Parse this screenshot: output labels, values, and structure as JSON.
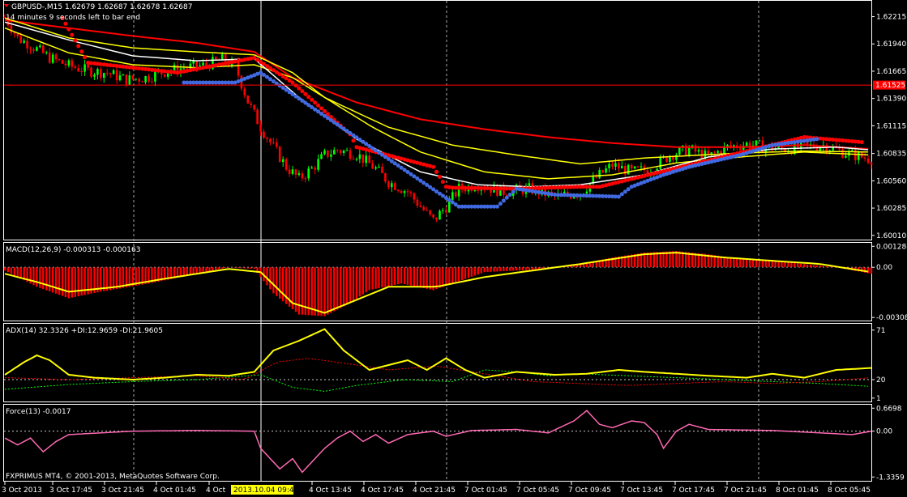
{
  "header": {
    "symbol_line": "GBPUSD-,M15  1.62679 1.62687 1.62678 1.62687",
    "timer_line": "14 minutes 9 seconds left to bar end"
  },
  "colors": {
    "background": "#000000",
    "frame": "#ffffff",
    "bull_candle": "#00ff00",
    "bear_candle": "#ff0000",
    "ma_red": "#ff0000",
    "ma_yellow": "#ffff00",
    "ma_white": "#ffffff",
    "stop_red": "#ff0000",
    "stop_blue": "#4169e1",
    "macd_hist": "#ff0000",
    "macd_signal": "#ffff00",
    "adx_line": "#ffff00",
    "plus_di": "#00ff00",
    "minus_di": "#ff0000",
    "force_line": "#ff69b4",
    "price_tag": "#ff0000"
  },
  "copyright": "FXPRIMUS MT4, © 2001-2013, MetaQuotes Software Corp.",
  "chart_data": [
    {
      "type": "candlestick",
      "title": "GBPUSD-,M15",
      "yticks": [
        "1.62215",
        "1.61940",
        "1.61665",
        "1.61390",
        "1.61115",
        "1.60835",
        "1.60560",
        "1.60285",
        "1.60010"
      ],
      "ylim": [
        1.6,
        1.6235
      ],
      "price_line": 1.61525,
      "price_line_label": "1.61525",
      "x_labels": [
        "3 Oct 2013",
        "3 Oct 17:45",
        "3 Oct 21:45",
        "4 Oct 01:45",
        "4 Oct",
        "4 Oct 13:45",
        "4 Oct 17:45",
        "4 Oct 21:45",
        "7 Oct 01:45",
        "7 Oct 05:45",
        "7 Oct 09:45",
        "7 Oct 13:45",
        "7 Oct 17:45",
        "7 Oct 21:45",
        "8 Oct 01:45",
        "8 Oct 05:45"
      ],
      "highlight_label": "2013.10.04 09:45",
      "close_path": [
        [
          0,
          1.6221
        ],
        [
          4,
          1.62
        ],
        [
          8,
          1.6193
        ],
        [
          14,
          1.618
        ],
        [
          20,
          1.6172
        ],
        [
          26,
          1.6167
        ],
        [
          32,
          1.6165
        ],
        [
          38,
          1.6158
        ],
        [
          44,
          1.616
        ],
        [
          50,
          1.6166
        ],
        [
          56,
          1.617
        ],
        [
          62,
          1.6172
        ],
        [
          68,
          1.6178
        ],
        [
          72,
          1.6172
        ],
        [
          76,
          1.6136
        ],
        [
          80,
          1.611
        ],
        [
          84,
          1.609
        ],
        [
          88,
          1.607
        ],
        [
          92,
          1.6058
        ],
        [
          96,
          1.6068
        ],
        [
          100,
          1.6082
        ],
        [
          104,
          1.6087
        ],
        [
          110,
          1.6083
        ],
        [
          116,
          1.6068
        ],
        [
          120,
          1.6055
        ],
        [
          126,
          1.6045
        ],
        [
          130,
          1.603
        ],
        [
          134,
          1.6016
        ],
        [
          138,
          1.603
        ],
        [
          142,
          1.6048
        ],
        [
          148,
          1.6052
        ],
        [
          156,
          1.6045
        ],
        [
          164,
          1.6048
        ],
        [
          172,
          1.604
        ],
        [
          180,
          1.6044
        ],
        [
          186,
          1.6062
        ],
        [
          190,
          1.6072
        ],
        [
          196,
          1.6065
        ],
        [
          202,
          1.6068
        ],
        [
          208,
          1.6082
        ],
        [
          214,
          1.6088
        ],
        [
          220,
          1.608
        ],
        [
          226,
          1.609
        ],
        [
          232,
          1.6093
        ],
        [
          238,
          1.609
        ],
        [
          244,
          1.6088
        ],
        [
          250,
          1.609
        ],
        [
          256,
          1.6092
        ],
        [
          262,
          1.6085
        ],
        [
          268,
          1.608
        ],
        [
          271,
          1.6078
        ]
      ],
      "ma_red": [
        [
          0,
          1.6218
        ],
        [
          20,
          1.621
        ],
        [
          40,
          1.6202
        ],
        [
          60,
          1.6195
        ],
        [
          78,
          1.6186
        ],
        [
          90,
          1.616
        ],
        [
          110,
          1.6135
        ],
        [
          130,
          1.6118
        ],
        [
          150,
          1.6108
        ],
        [
          170,
          1.61
        ],
        [
          190,
          1.6094
        ],
        [
          210,
          1.609
        ],
        [
          230,
          1.609
        ],
        [
          250,
          1.6092
        ],
        [
          271,
          1.6088
        ]
      ],
      "ma_yellow_upper": [
        [
          0,
          1.622
        ],
        [
          20,
          1.62
        ],
        [
          40,
          1.619
        ],
        [
          60,
          1.6186
        ],
        [
          78,
          1.6183
        ],
        [
          90,
          1.6165
        ],
        [
          100,
          1.614
        ],
        [
          120,
          1.611
        ],
        [
          140,
          1.6092
        ],
        [
          160,
          1.6082
        ],
        [
          180,
          1.6073
        ],
        [
          200,
          1.6079
        ],
        [
          230,
          1.6084
        ],
        [
          250,
          1.6086
        ],
        [
          271,
          1.6085
        ]
      ],
      "ma_yellow_lower": [
        [
          0,
          1.621
        ],
        [
          20,
          1.6185
        ],
        [
          40,
          1.6173
        ],
        [
          60,
          1.617
        ],
        [
          78,
          1.6173
        ],
        [
          90,
          1.616
        ],
        [
          100,
          1.614
        ],
        [
          115,
          1.611
        ],
        [
          130,
          1.6085
        ],
        [
          150,
          1.6065
        ],
        [
          170,
          1.6058
        ],
        [
          190,
          1.6062
        ],
        [
          210,
          1.6074
        ],
        [
          230,
          1.608
        ],
        [
          250,
          1.6085
        ],
        [
          271,
          1.6082
        ]
      ],
      "ma_white": [
        [
          0,
          1.6216
        ],
        [
          20,
          1.6198
        ],
        [
          40,
          1.6182
        ],
        [
          60,
          1.6177
        ],
        [
          78,
          1.6179
        ],
        [
          92,
          1.614
        ],
        [
          110,
          1.6098
        ],
        [
          130,
          1.6065
        ],
        [
          148,
          1.6052
        ],
        [
          164,
          1.605
        ],
        [
          180,
          1.6052
        ],
        [
          200,
          1.6062
        ],
        [
          220,
          1.608
        ],
        [
          240,
          1.6088
        ],
        [
          260,
          1.609
        ],
        [
          271,
          1.6087
        ]
      ],
      "stop_red": [
        [
          18,
          1.622
        ],
        [
          26,
          1.6175
        ],
        [
          40,
          1.617
        ],
        [
          54,
          1.6165
        ],
        [
          78,
          1.618
        ],
        [
          90,
          1.6155
        ],
        [
          108,
          1.6103
        ],
        [
          110,
          1.609
        ],
        [
          134,
          1.607
        ],
        [
          138,
          1.605
        ],
        [
          140,
          1.6049
        ],
        [
          160,
          1.6048
        ],
        [
          180,
          1.605
        ],
        [
          186,
          1.605
        ],
        [
          250,
          1.61
        ],
        [
          268,
          1.6095
        ]
      ],
      "stop_blue": [
        [
          56,
          1.6155
        ],
        [
          72,
          1.6155
        ],
        [
          80,
          1.6165
        ],
        [
          142,
          1.603
        ],
        [
          154,
          1.603
        ],
        [
          160,
          1.6048
        ],
        [
          172,
          1.6042
        ],
        [
          192,
          1.604
        ],
        [
          196,
          1.605
        ],
        [
          206,
          1.6062
        ],
        [
          214,
          1.607
        ],
        [
          230,
          1.6082
        ],
        [
          240,
          1.6092
        ],
        [
          254,
          1.6098
        ]
      ]
    },
    {
      "type": "macd",
      "title": "MACD(12,26,9) -0.000313 -0.000163",
      "yticks": [
        "0.001286",
        "0.00",
        "-0.00308"
      ],
      "ylim": [
        -0.00312,
        0.00135
      ],
      "hist_path": [
        [
          0,
          -0.0002
        ],
        [
          10,
          -0.0012
        ],
        [
          20,
          -0.0019
        ],
        [
          30,
          -0.0015
        ],
        [
          45,
          -0.001
        ],
        [
          60,
          -0.0004
        ],
        [
          70,
          0.0
        ],
        [
          78,
          -0.0001
        ],
        [
          84,
          -0.0016
        ],
        [
          92,
          -0.0029
        ],
        [
          100,
          -0.003
        ],
        [
          108,
          -0.0022
        ],
        [
          114,
          -0.0014
        ],
        [
          124,
          -0.001
        ],
        [
          134,
          -0.0014
        ],
        [
          140,
          -0.001
        ],
        [
          150,
          -0.0003
        ],
        [
          170,
          -0.0001
        ],
        [
          180,
          0.0002
        ],
        [
          190,
          0.0006
        ],
        [
          200,
          0.0009
        ],
        [
          210,
          0.001
        ],
        [
          220,
          0.0008
        ],
        [
          230,
          0.0005
        ],
        [
          245,
          0.0003
        ],
        [
          260,
          0.0
        ],
        [
          271,
          -0.0004
        ]
      ],
      "signal_path": [
        [
          0,
          -0.0004
        ],
        [
          10,
          -0.0009
        ],
        [
          20,
          -0.0015
        ],
        [
          35,
          -0.0012
        ],
        [
          50,
          -0.0007
        ],
        [
          70,
          -0.0001
        ],
        [
          80,
          -0.0003
        ],
        [
          90,
          -0.0022
        ],
        [
          100,
          -0.0028
        ],
        [
          110,
          -0.002
        ],
        [
          120,
          -0.0012
        ],
        [
          135,
          -0.0012
        ],
        [
          150,
          -0.0006
        ],
        [
          165,
          -0.0002
        ],
        [
          180,
          0.0002
        ],
        [
          200,
          0.0008
        ],
        [
          210,
          0.0009
        ],
        [
          225,
          0.0006
        ],
        [
          240,
          0.0004
        ],
        [
          255,
          0.0002
        ],
        [
          271,
          -0.0003
        ]
      ]
    },
    {
      "type": "adx",
      "title": "ADX(14) 32.3326 +DI:12.9659 -DI:21.9605",
      "yticks": [
        "71",
        "20",
        "1"
      ],
      "ylim": [
        0,
        75
      ],
      "adx_path": [
        [
          0,
          25
        ],
        [
          6,
          38
        ],
        [
          10,
          45
        ],
        [
          14,
          40
        ],
        [
          20,
          25
        ],
        [
          28,
          22
        ],
        [
          40,
          20
        ],
        [
          50,
          22
        ],
        [
          60,
          25
        ],
        [
          70,
          24
        ],
        [
          78,
          28
        ],
        [
          84,
          50
        ],
        [
          92,
          60
        ],
        [
          100,
          72
        ],
        [
          106,
          50
        ],
        [
          114,
          30
        ],
        [
          120,
          35
        ],
        [
          126,
          40
        ],
        [
          132,
          30
        ],
        [
          138,
          42
        ],
        [
          144,
          30
        ],
        [
          150,
          22
        ],
        [
          160,
          28
        ],
        [
          172,
          25
        ],
        [
          182,
          26
        ],
        [
          192,
          30
        ],
        [
          200,
          28
        ],
        [
          210,
          26
        ],
        [
          220,
          24
        ],
        [
          232,
          22
        ],
        [
          240,
          26
        ],
        [
          250,
          22
        ],
        [
          260,
          30
        ],
        [
          271,
          32
        ]
      ],
      "plus_di_path": [
        [
          0,
          10
        ],
        [
          20,
          15
        ],
        [
          40,
          18
        ],
        [
          60,
          20
        ],
        [
          80,
          25
        ],
        [
          90,
          12
        ],
        [
          100,
          8
        ],
        [
          110,
          14
        ],
        [
          125,
          20
        ],
        [
          140,
          18
        ],
        [
          150,
          30
        ],
        [
          160,
          28
        ],
        [
          170,
          24
        ],
        [
          180,
          26
        ],
        [
          195,
          24
        ],
        [
          210,
          22
        ],
        [
          225,
          20
        ],
        [
          240,
          18
        ],
        [
          255,
          16
        ],
        [
          271,
          13
        ]
      ],
      "minus_di_path": [
        [
          0,
          22
        ],
        [
          20,
          20
        ],
        [
          40,
          22
        ],
        [
          60,
          24
        ],
        [
          75,
          20
        ],
        [
          85,
          38
        ],
        [
          95,
          42
        ],
        [
          108,
          36
        ],
        [
          120,
          30
        ],
        [
          135,
          34
        ],
        [
          150,
          26
        ],
        [
          165,
          18
        ],
        [
          180,
          16
        ],
        [
          195,
          14
        ],
        [
          210,
          16
        ],
        [
          225,
          18
        ],
        [
          240,
          16
        ],
        [
          255,
          18
        ],
        [
          271,
          22
        ]
      ],
      "level": 20
    },
    {
      "type": "force",
      "title": "Force(13) -0.0017",
      "yticks": [
        "0.6698",
        "0.00",
        "-1.3359"
      ],
      "ylim": [
        -1.4,
        0.7
      ],
      "force_path": [
        [
          0,
          -0.2
        ],
        [
          4,
          -0.4
        ],
        [
          8,
          -0.2
        ],
        [
          12,
          -0.6
        ],
        [
          16,
          -0.3
        ],
        [
          20,
          -0.1
        ],
        [
          30,
          -0.05
        ],
        [
          40,
          0.0
        ],
        [
          60,
          0.02
        ],
        [
          78,
          0.0
        ],
        [
          80,
          -0.5
        ],
        [
          84,
          -0.9
        ],
        [
          86,
          -1.1
        ],
        [
          90,
          -0.8
        ],
        [
          93,
          -1.2
        ],
        [
          96,
          -0.9
        ],
        [
          100,
          -0.5
        ],
        [
          104,
          -0.2
        ],
        [
          108,
          0.0
        ],
        [
          112,
          -0.3
        ],
        [
          116,
          -0.1
        ],
        [
          120,
          -0.35
        ],
        [
          126,
          -0.1
        ],
        [
          134,
          0.0
        ],
        [
          138,
          -0.15
        ],
        [
          146,
          0.02
        ],
        [
          160,
          0.05
        ],
        [
          170,
          -0.05
        ],
        [
          178,
          0.3
        ],
        [
          182,
          0.6
        ],
        [
          186,
          0.2
        ],
        [
          190,
          0.1
        ],
        [
          196,
          0.3
        ],
        [
          200,
          0.25
        ],
        [
          204,
          -0.1
        ],
        [
          206,
          -0.5
        ],
        [
          210,
          0.0
        ],
        [
          214,
          0.2
        ],
        [
          220,
          0.05
        ],
        [
          240,
          0.02
        ],
        [
          255,
          -0.05
        ],
        [
          265,
          -0.1
        ],
        [
          271,
          -0.002
        ]
      ],
      "level": 0
    }
  ]
}
